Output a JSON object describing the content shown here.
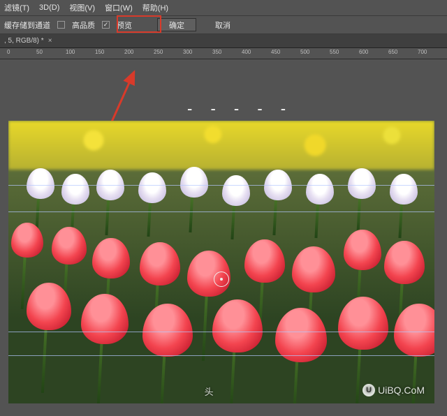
{
  "menubar": {
    "filter": "滤镜(T)",
    "threeD": "3D(D)",
    "view": "视图(V)",
    "window": "窗口(W)",
    "help": "帮助(H)"
  },
  "optionsbar": {
    "save_to_channel": "缓存储到通道",
    "high_quality_label": "高品质",
    "preview_label": "预览",
    "ok_label": "确定",
    "cancel_label": "取消",
    "high_quality_checked": false,
    "preview_checked": true
  },
  "tab": {
    "title": ", 5, RGB/8) *",
    "close": "×"
  },
  "ruler": {
    "marks": [
      "0",
      "50",
      "100",
      "150",
      "200",
      "250",
      "300",
      "350",
      "400",
      "450",
      "500",
      "550",
      "600",
      "650",
      "700"
    ]
  },
  "canvas": {
    "dashes": "- - - - -"
  },
  "watermark": {
    "site": "UiBQ.CoM",
    "head": "头",
    "logo": "U"
  }
}
